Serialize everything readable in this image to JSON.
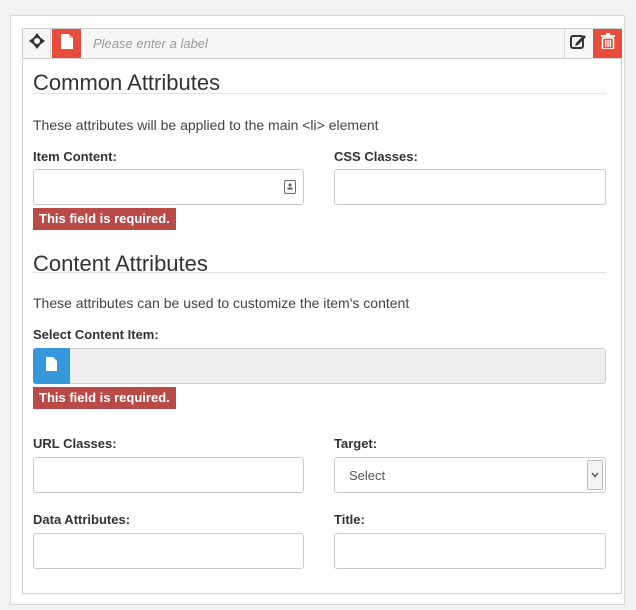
{
  "label_bar": {
    "placeholder": "Please enter a label",
    "icons": {
      "move": "move-arrows-icon",
      "type": "document-icon",
      "edit": "edit-icon",
      "delete": "trash-icon"
    }
  },
  "common": {
    "title": "Common Attributes",
    "description": "These attributes will be applied to the main <li> element",
    "item_content_label": "Item Content:",
    "item_content_value": "",
    "css_classes_label": "CSS Classes:",
    "css_classes_value": "",
    "error": "This field is required."
  },
  "content": {
    "title": "Content Attributes",
    "description": "These attributes can be used to customize the item's content",
    "select_item_label": "Select Content Item:",
    "error": "This field is required.",
    "url_classes_label": "URL Classes:",
    "url_classes_value": "",
    "target_label": "Target:",
    "target_value": "Select",
    "data_attributes_label": "Data Attributes:",
    "data_attributes_value": "",
    "title_label": "Title:",
    "title_value": ""
  },
  "colors": {
    "danger": "#e74c3c",
    "error_badge": "#b94a48",
    "primary": "#3498db"
  }
}
